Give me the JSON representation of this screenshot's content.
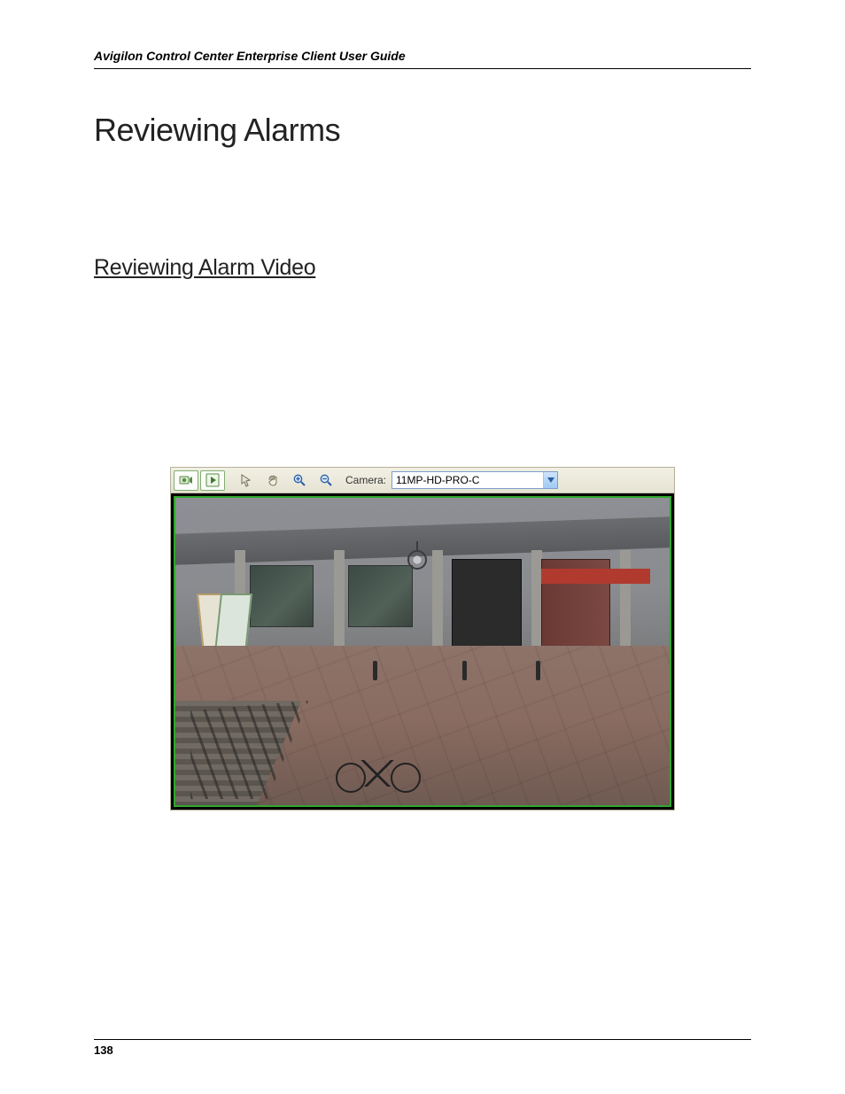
{
  "header": {
    "running_title": "Avigilon Control Center Enterprise Client User Guide"
  },
  "headings": {
    "h1": "Reviewing Alarms",
    "h2": "Reviewing Alarm Video"
  },
  "toolbar": {
    "camera_label": "Camera:",
    "camera_value": "11MP-HD-PRO-C",
    "icons": {
      "live": "camera-live-icon",
      "play": "play-icon",
      "pointer": "pointer-icon",
      "hand": "hand-pan-icon",
      "zoom_in": "zoom-in-icon",
      "zoom_out": "zoom-out-icon",
      "dropdown": "chevron-down-icon"
    }
  },
  "footer": {
    "page_number": "138"
  }
}
